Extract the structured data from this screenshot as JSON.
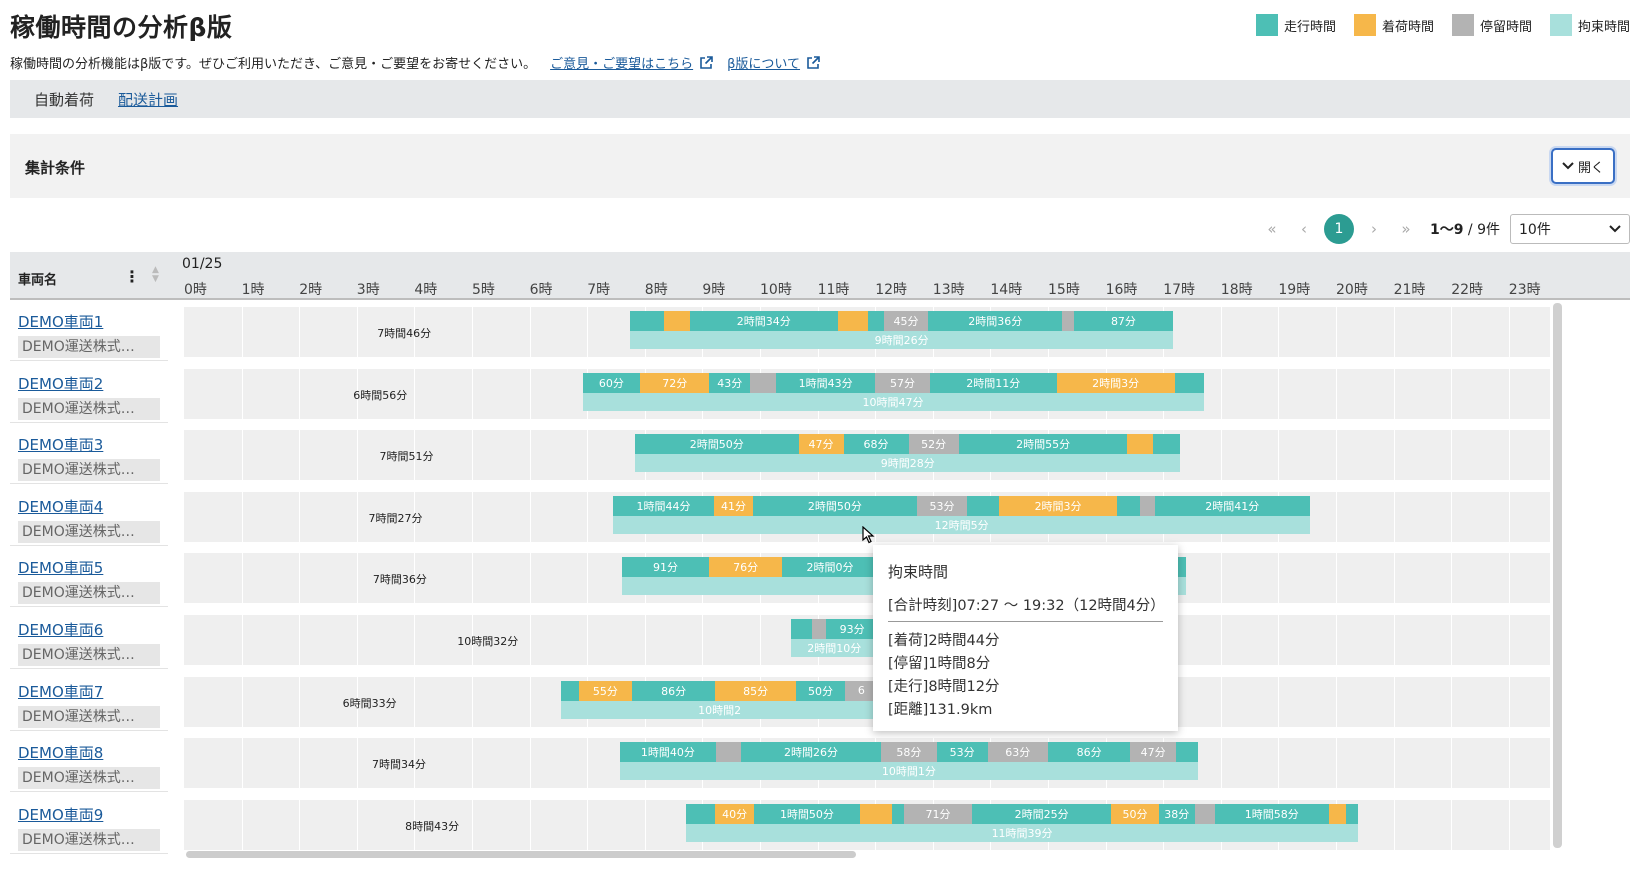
{
  "page": {
    "title": "稼働時間の分析β版",
    "notice": "稼働時間の分析機能はβ版です。ぜひご利用いただき、ご意見・ご要望をお寄せください。",
    "feedback_link": "ご意見・ご要望はこちら",
    "beta_link": "β版について"
  },
  "legend": [
    {
      "label": "走行時間",
      "color": "#4dbfb5"
    },
    {
      "label": "着荷時間",
      "color": "#f6b74a"
    },
    {
      "label": "停留時間",
      "color": "#b3b3b3"
    },
    {
      "label": "拘束時間",
      "color": "#a8e0dc"
    }
  ],
  "tabs": [
    {
      "label": "自動着荷",
      "active": true
    },
    {
      "label": "配送計画",
      "active": false
    }
  ],
  "conditions": {
    "title": "集計条件",
    "open_button": "開く"
  },
  "pager": {
    "current": "1",
    "range_bold": "1〜9",
    "range_rest": " / 9件",
    "per_page": "10件"
  },
  "grid": {
    "name_header": "車両名",
    "date": "01/25",
    "hours": [
      "0時",
      "1時",
      "2時",
      "3時",
      "4時",
      "5時",
      "6時",
      "7時",
      "8時",
      "9時",
      "10時",
      "11時",
      "12時",
      "13時",
      "14時",
      "15時",
      "16時",
      "17時",
      "18時",
      "19時",
      "20時",
      "21時",
      "22時",
      "23時"
    ]
  },
  "rows": [
    {
      "name": "DEMO車両1",
      "company": "DEMO運送株式…",
      "total": "7時間46分",
      "bind": {
        "start": 7.75,
        "end": 17.17,
        "label": "9時間26分"
      },
      "segs": [
        [
          "r",
          7.75,
          8.33,
          ""
        ],
        [
          "c",
          8.33,
          8.78,
          ""
        ],
        [
          "r",
          8.78,
          11.35,
          "2時間34分"
        ],
        [
          "c",
          11.35,
          11.87,
          ""
        ],
        [
          "r",
          11.87,
          12.15,
          ""
        ],
        [
          "s",
          12.15,
          12.92,
          "45分"
        ],
        [
          "r",
          12.92,
          15.25,
          "2時間36分"
        ],
        [
          "s",
          15.25,
          15.45,
          ""
        ],
        [
          "r",
          15.45,
          17.17,
          "87分"
        ]
      ]
    },
    {
      "name": "DEMO車両2",
      "company": "DEMO運送株式…",
      "total": "6時間56分",
      "bind": {
        "start": 6.92,
        "end": 17.7,
        "label": "10時間47分"
      },
      "segs": [
        [
          "r",
          6.92,
          7.92,
          "60分"
        ],
        [
          "c",
          7.92,
          9.12,
          "72分"
        ],
        [
          "r",
          9.12,
          9.83,
          "43分"
        ],
        [
          "s",
          9.83,
          10.28,
          ""
        ],
        [
          "r",
          10.28,
          12.0,
          "1時間43分"
        ],
        [
          "s",
          12.0,
          12.95,
          "57分"
        ],
        [
          "r",
          12.95,
          15.15,
          "2時間11分"
        ],
        [
          "c",
          15.15,
          17.2,
          "2時間3分"
        ],
        [
          "r",
          17.2,
          17.7,
          ""
        ]
      ]
    },
    {
      "name": "DEMO車両3",
      "company": "DEMO運送株式…",
      "total": "7時間51分",
      "bind": {
        "start": 7.83,
        "end": 17.3,
        "label": "9時間28分"
      },
      "segs": [
        [
          "r",
          7.83,
          10.67,
          "2時間50分"
        ],
        [
          "c",
          10.67,
          11.45,
          "47分"
        ],
        [
          "r",
          11.45,
          12.58,
          "68分"
        ],
        [
          "s",
          12.58,
          13.45,
          "52分"
        ],
        [
          "r",
          13.45,
          16.38,
          "2時間55分"
        ],
        [
          "c",
          16.38,
          16.82,
          ""
        ],
        [
          "r",
          16.82,
          17.3,
          ""
        ]
      ]
    },
    {
      "name": "DEMO車両4",
      "company": "DEMO運送株式…",
      "total": "7時間27分",
      "bind": {
        "start": 7.45,
        "end": 19.55,
        "label": "12時間5分"
      },
      "segs": [
        [
          "r",
          7.45,
          9.2,
          "1時間44分"
        ],
        [
          "c",
          9.2,
          9.88,
          "41分"
        ],
        [
          "r",
          9.88,
          12.72,
          "2時間50分"
        ],
        [
          "s",
          12.72,
          13.6,
          "53分"
        ],
        [
          "r",
          13.6,
          14.15,
          ""
        ],
        [
          "c",
          14.15,
          16.2,
          "2時間3分"
        ],
        [
          "r",
          16.2,
          16.6,
          ""
        ],
        [
          "s",
          16.6,
          16.85,
          ""
        ],
        [
          "r",
          16.85,
          19.55,
          "2時間41分"
        ]
      ]
    },
    {
      "name": "DEMO車両5",
      "company": "DEMO運送株式…",
      "total": "7時間36分",
      "bind": {
        "start": 7.6,
        "end": 17.4,
        "label": ""
      },
      "segs": [
        [
          "r",
          7.6,
          9.12,
          "91分"
        ],
        [
          "c",
          9.12,
          10.38,
          "76分"
        ],
        [
          "r",
          10.38,
          12.05,
          "2時間0分"
        ],
        [
          "r",
          17.05,
          17.4,
          ""
        ]
      ]
    },
    {
      "name": "DEMO車両6",
      "company": "DEMO運送株式…",
      "total": "10時間32分",
      "bind": {
        "start": 10.53,
        "end": 12.05,
        "label": "2時間10分"
      },
      "segs": [
        [
          "r",
          10.53,
          10.9,
          ""
        ],
        [
          "s",
          10.9,
          11.15,
          ""
        ],
        [
          "r",
          11.15,
          12.05,
          "93分"
        ]
      ]
    },
    {
      "name": "DEMO車両7",
      "company": "DEMO運送株式…",
      "total": "6時間33分",
      "bind": {
        "start": 6.55,
        "end": 12.05,
        "label": "10時間2"
      },
      "segs": [
        [
          "r",
          6.55,
          6.85,
          ""
        ],
        [
          "c",
          6.85,
          7.78,
          "55分"
        ],
        [
          "r",
          7.78,
          9.22,
          "86分"
        ],
        [
          "c",
          9.22,
          10.63,
          "85分"
        ],
        [
          "r",
          10.63,
          11.47,
          "50分"
        ],
        [
          "s",
          11.47,
          12.05,
          "6"
        ]
      ]
    },
    {
      "name": "DEMO車両8",
      "company": "DEMO運送株式…",
      "total": "7時間34分",
      "bind": {
        "start": 7.57,
        "end": 17.6,
        "label": "10時間1分"
      },
      "segs": [
        [
          "r",
          7.57,
          9.23,
          "1時間40分"
        ],
        [
          "s",
          9.23,
          9.67,
          ""
        ],
        [
          "r",
          9.67,
          12.1,
          "2時間26分"
        ],
        [
          "s",
          12.1,
          13.07,
          "58分"
        ],
        [
          "r",
          13.07,
          13.95,
          "53分"
        ],
        [
          "s",
          13.95,
          15.0,
          "63分"
        ],
        [
          "r",
          15.0,
          16.43,
          "86分"
        ],
        [
          "s",
          16.43,
          17.22,
          "47分"
        ],
        [
          "r",
          17.22,
          17.6,
          ""
        ]
      ]
    },
    {
      "name": "DEMO車両9",
      "company": "DEMO運送株式…",
      "total": "8時間43分",
      "bind": {
        "start": 8.72,
        "end": 20.38,
        "label": "11時間39分"
      },
      "segs": [
        [
          "r",
          8.72,
          9.22,
          ""
        ],
        [
          "c",
          9.22,
          9.9,
          "40分"
        ],
        [
          "r",
          9.9,
          11.73,
          "1時間50分"
        ],
        [
          "c",
          11.73,
          12.3,
          ""
        ],
        [
          "r",
          12.3,
          12.5,
          ""
        ],
        [
          "s",
          12.5,
          13.68,
          "71分"
        ],
        [
          "r",
          13.68,
          16.1,
          "2時間25分"
        ],
        [
          "c",
          16.1,
          16.92,
          "50分"
        ],
        [
          "r",
          16.92,
          17.55,
          "38分"
        ],
        [
          "s",
          17.55,
          17.9,
          ""
        ],
        [
          "r",
          17.9,
          19.87,
          "1時間58分"
        ],
        [
          "c",
          19.87,
          20.18,
          ""
        ],
        [
          "r",
          20.18,
          20.38,
          ""
        ]
      ]
    }
  ],
  "tooltip": {
    "title": "拘束時間",
    "total": "[合計時刻]07:27 〜 19:32（12時間4分）",
    "lines": [
      "[着荷]2時間44分",
      "[停留]1時間8分",
      "[走行]8時間12分",
      "[距離]131.9km"
    ]
  }
}
